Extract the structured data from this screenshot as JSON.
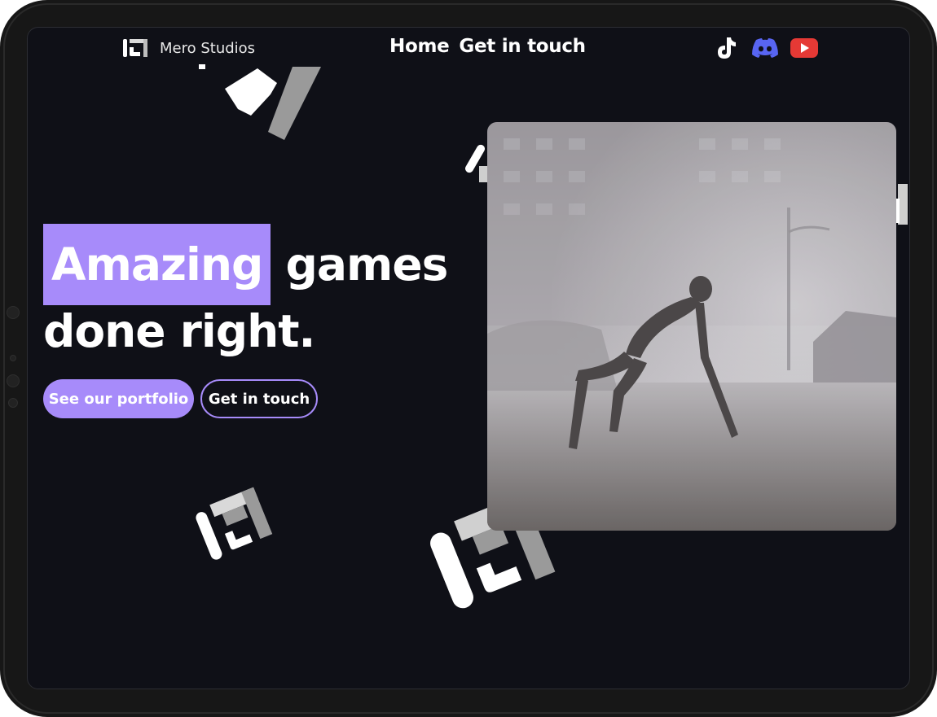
{
  "brand": {
    "name": "Mero Studios"
  },
  "nav": {
    "links": [
      {
        "label": "Home"
      },
      {
        "label": "Get in touch"
      }
    ]
  },
  "socials": [
    {
      "name": "tiktok-icon",
      "color": "#ffffff"
    },
    {
      "name": "discord-icon",
      "color": "#5865f2"
    },
    {
      "name": "youtube-icon",
      "color": "#e53935"
    }
  ],
  "hero": {
    "highlight": "Amazing",
    "title_rest": "games",
    "title_line2": "done right.",
    "primary_button": "See our portfolio",
    "secondary_button": "Get in touch"
  },
  "colors": {
    "accent": "#a78bfa",
    "background": "#0f1017",
    "device": "#171717"
  }
}
